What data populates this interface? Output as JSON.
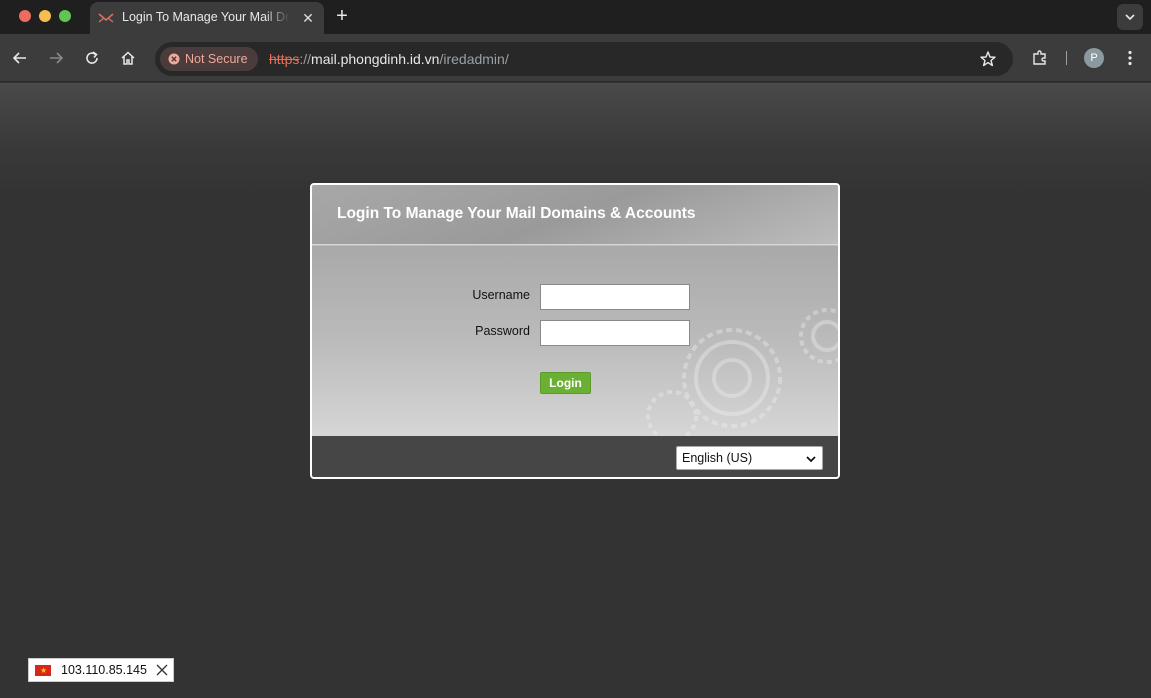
{
  "browser": {
    "tab_title": "Login To Manage Your Mail Domains & Accounts",
    "security_label": "Not Secure",
    "url": {
      "scheme": "https",
      "separator": "://",
      "host": "mail.phongdinh.id.vn",
      "path": "/iredadmin/"
    },
    "profile_initial": "P",
    "icons": [
      "close-icon",
      "plus-icon",
      "back-icon",
      "forward-icon",
      "reload-icon",
      "home-icon",
      "star-icon",
      "extensions-icon",
      "menu-icon",
      "chevron-down-icon"
    ]
  },
  "login": {
    "title": "Login To Manage Your Mail Domains & Accounts",
    "username_label": "Username",
    "username_value": "",
    "password_label": "Password",
    "password_value": "",
    "submit_label": "Login",
    "language_selected": "English (US)"
  },
  "status_chip": {
    "ip": "103.110.85.145"
  },
  "colors": {
    "page_background": "#333333",
    "login_button": "#6ab033",
    "not_secure": "#e8705a"
  }
}
